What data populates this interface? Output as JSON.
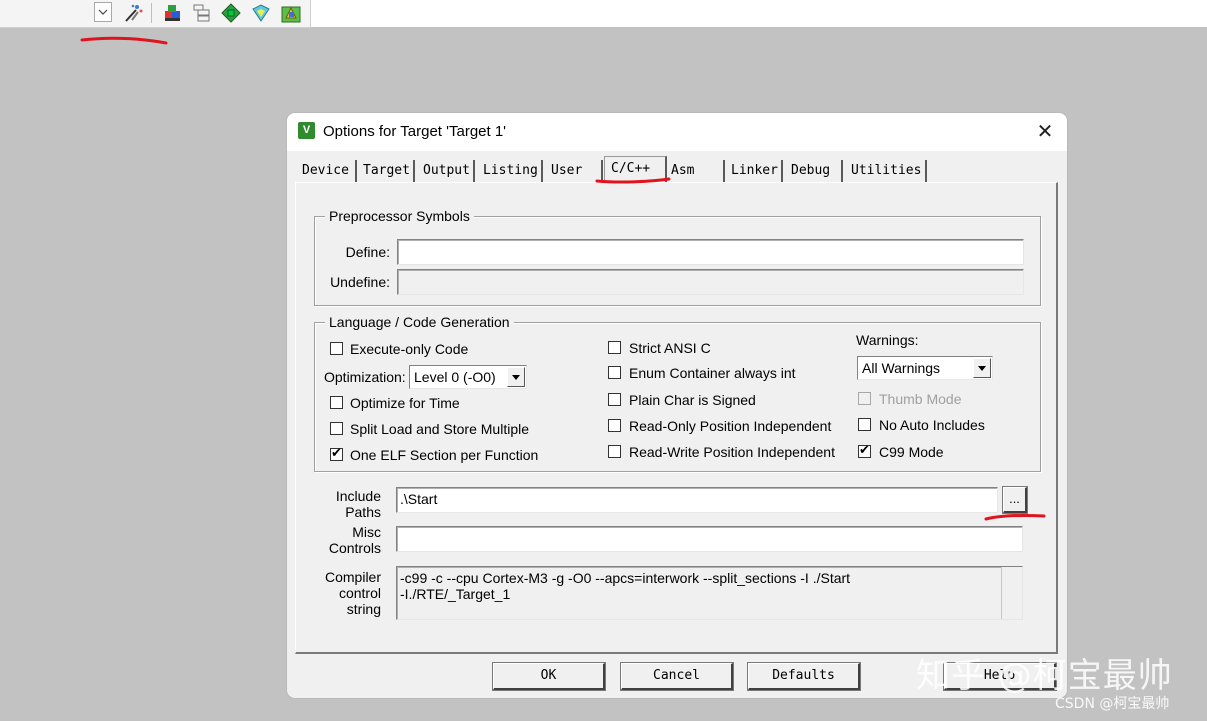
{
  "toolbar": {
    "icons": [
      "dropdown-arrow-icon",
      "magic-wand-icon",
      "target-options-icon",
      "manage-components-icon",
      "pack-installer-icon",
      "select-packs-icon",
      "manage-run-time-icon"
    ]
  },
  "dialog": {
    "title": "Options for Target 'Target 1'",
    "app_icon_letter": "V",
    "close_symbol": "✕",
    "tabs": [
      "Device",
      "Target",
      "Output",
      "Listing",
      "User",
      "C/C++",
      "Asm",
      "Linker",
      "Debug",
      "Utilities"
    ],
    "active_tab": "C/C++",
    "preprocessor": {
      "legend": "Preprocessor Symbols",
      "define_label": "Define:",
      "define_value": "",
      "undefine_label": "Undefine:",
      "undefine_value": ""
    },
    "language": {
      "legend": "Language / Code Generation",
      "execute_only": {
        "label": "Execute-only Code",
        "checked": false
      },
      "optimization_label": "Optimization:",
      "optimization_value": "Level 0 (-O0)",
      "optimize_time": {
        "label": "Optimize for Time",
        "checked": false
      },
      "split_load": {
        "label": "Split Load and Store Multiple",
        "checked": false
      },
      "one_elf": {
        "label": "One ELF Section per Function",
        "checked": true
      },
      "strict_ansi": {
        "label": "Strict ANSI C",
        "checked": false
      },
      "enum_container": {
        "label": "Enum Container always int",
        "checked": false
      },
      "plain_char": {
        "label": "Plain Char is Signed",
        "checked": false
      },
      "ro_pos": {
        "label": "Read-Only Position Independent",
        "checked": false
      },
      "rw_pos": {
        "label": "Read-Write Position Independent",
        "checked": false
      },
      "warnings_label": "Warnings:",
      "warnings_value": "All Warnings",
      "thumb_mode": {
        "label": "Thumb Mode",
        "checked": false,
        "disabled": true
      },
      "no_auto_includes": {
        "label": "No Auto Includes",
        "checked": false
      },
      "c99_mode": {
        "label": "C99 Mode",
        "checked": true
      }
    },
    "include_paths_label_1": "Include",
    "include_paths_label_2": "Paths",
    "include_paths_value": ".\\Start",
    "browse_label": "...",
    "misc_label_1": "Misc",
    "misc_label_2": "Controls",
    "misc_value": "",
    "compiler_label_1": "Compiler",
    "compiler_label_2": "control",
    "compiler_label_3": "string",
    "compiler_line_1": "-c99 -c --cpu Cortex-M3 -g -O0 --apcs=interwork --split_sections -I ./Start",
    "compiler_line_2": "-I./RTE/_Target_1",
    "buttons": {
      "ok": "OK",
      "cancel": "Cancel",
      "defaults": "Defaults",
      "help": "Help"
    }
  },
  "watermark": "知乎 @柯宝最帅",
  "csdn_watermark": "CSDN @柯宝最帅",
  "colors": {
    "annotation": "#e0141e",
    "dialog_bg": "#f0f0f0",
    "desktop": "#c2c2c2"
  }
}
